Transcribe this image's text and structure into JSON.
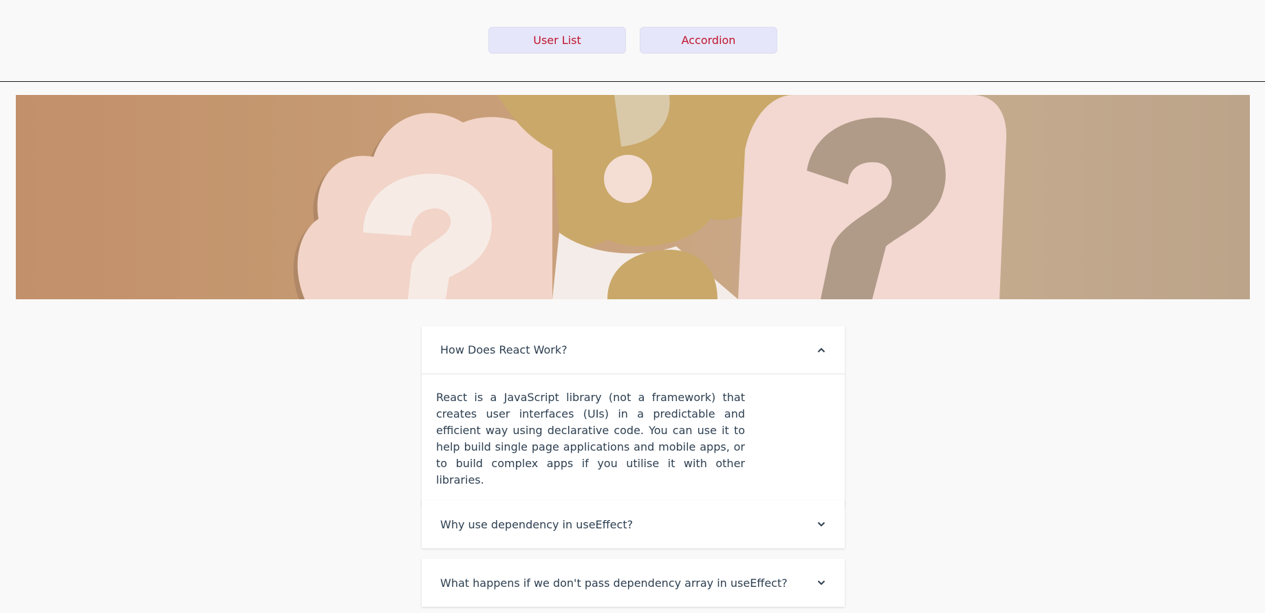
{
  "nav": {
    "user_list": "User List",
    "accordion": "Accordion"
  },
  "banner": {
    "icon": "question-mark-paper-cutouts-image"
  },
  "accordion": {
    "items": [
      {
        "title": "How Does React Work?",
        "expanded": true,
        "body": "React is a JavaScript library (not a framework) that creates user interfaces (UIs) in a predictable and efficient way using declarative code. You can use it to help build single page applications and mobile apps, or to build complex apps if you utilise it with other libraries."
      },
      {
        "title": "Why use dependency in useEffect?",
        "expanded": false
      },
      {
        "title": "What happens if we don't pass dependency array in useEffect?",
        "expanded": false
      }
    ]
  },
  "colors": {
    "nav_button_bg": "#e6e6fa",
    "nav_button_text": "#c0142a",
    "page_bg": "#f9f9f9",
    "text": "#2c3e50"
  }
}
